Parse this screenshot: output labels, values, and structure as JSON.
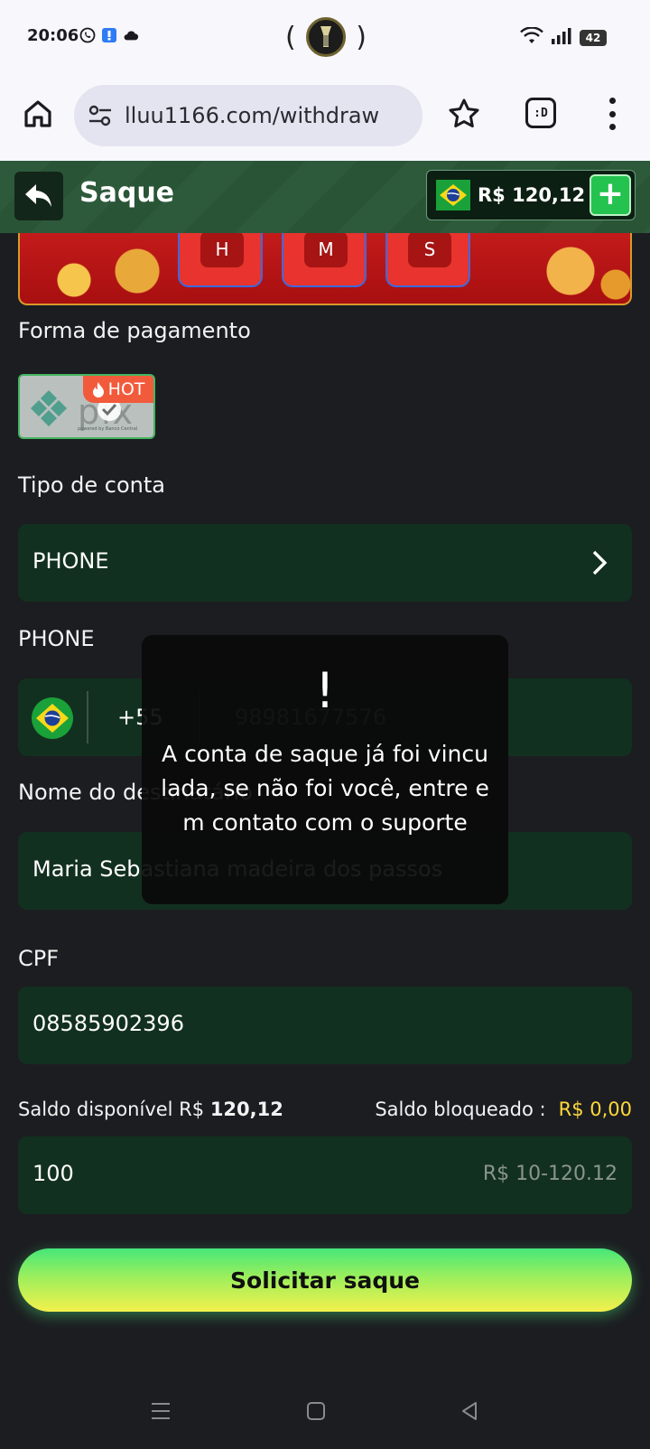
{
  "status_bar": {
    "time": "20:06",
    "left_icons": [
      "whatsapp-icon",
      "notification-icon",
      "cloud-icon"
    ],
    "center_open": "(",
    "center_close": ")",
    "battery": "42"
  },
  "browser": {
    "url": "lluu1166.com/withdraw",
    "tabs_label": ":D"
  },
  "header": {
    "title": "Saque",
    "balance": "R$ 120,12",
    "plus_label": "+"
  },
  "banner": {
    "timer_units": [
      "H",
      "M",
      "S"
    ]
  },
  "payment": {
    "label": "Forma de pagamento",
    "method_logo_text": "pix",
    "method_sub": "powered by Banco Central",
    "hot_badge": "HOT"
  },
  "account_type": {
    "label": "Tipo de conta",
    "value": "PHONE"
  },
  "phone": {
    "label": "PHONE",
    "country_code": "+55",
    "value": "98981677576"
  },
  "recipient": {
    "label": "Nome do destinatário",
    "value": "Maria Sebastiana madeira dos passos"
  },
  "cpf": {
    "label": "CPF",
    "value": "08585902396"
  },
  "balances": {
    "available_label": "Saldo disponível R$",
    "available_value": "120,12",
    "blocked_label": "Saldo bloqueado :",
    "blocked_value": "R$ 0,00"
  },
  "amount": {
    "value": "100",
    "range": "R$ 10-120.12"
  },
  "submit_label": "Solicitar saque",
  "toast": {
    "icon": "!",
    "message": "A conta de saque já foi vinculada, se não foi você, entre em contato com o suporte"
  },
  "colors": {
    "accent_green": "#24c24f",
    "field_bg": "#12301f",
    "blocked_yellow": "#ffd83a"
  }
}
